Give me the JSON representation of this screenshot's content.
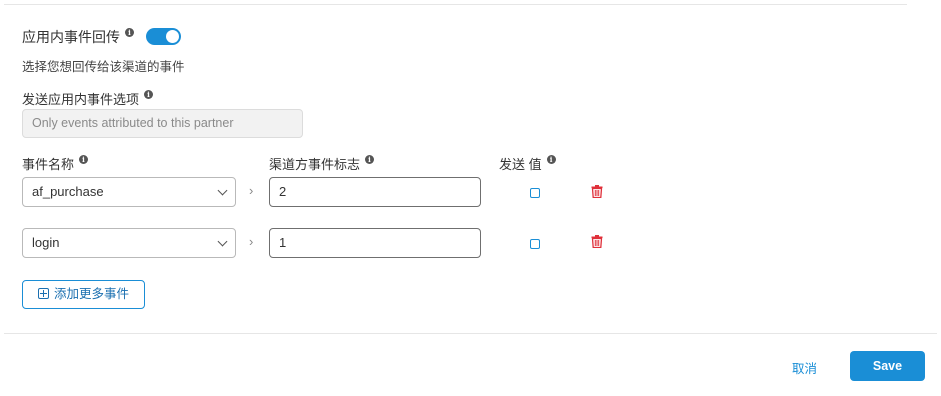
{
  "section": {
    "title": "应用内事件回传",
    "toggle_on": true,
    "subtitle": "选择您想回传给该渠道的事件"
  },
  "send_option": {
    "label": "发送应用内事件选项",
    "value": "Only events attributed to this partner"
  },
  "columns": {
    "event_name": "事件名称",
    "partner_event": "渠道方事件标志",
    "send_value": "发送 值"
  },
  "rows": [
    {
      "event": "af_purchase",
      "partner_id": "2",
      "send_value": false
    },
    {
      "event": "login",
      "partner_id": "1",
      "send_value": false
    }
  ],
  "arrow_glyph": "›",
  "add_button": "添加更多事件",
  "footer": {
    "cancel": "取消",
    "save": "Save"
  },
  "colors": {
    "accent": "#1a8ed6",
    "delete": "#e0303a"
  }
}
